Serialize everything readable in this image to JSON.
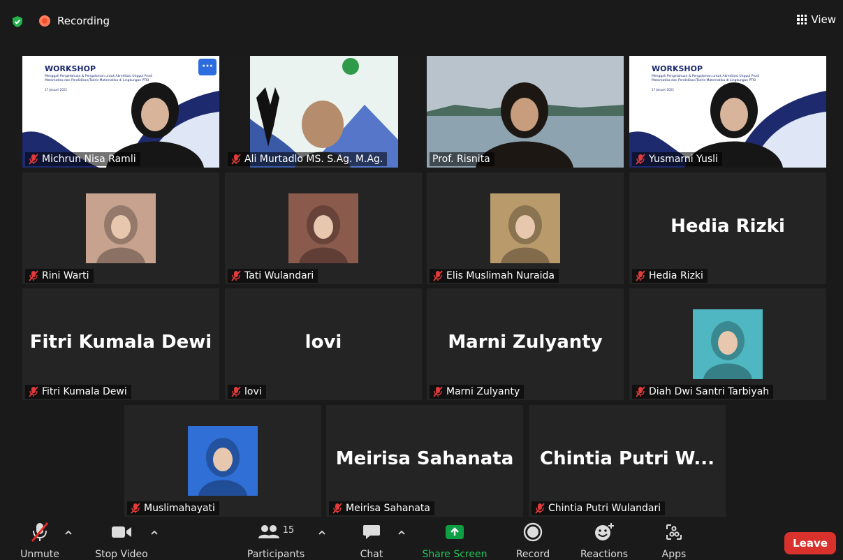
{
  "topbar": {
    "recording_label": "Recording",
    "view_label": "View"
  },
  "participants": [
    {
      "name": "Michrun Nisa Ramli",
      "type": "video",
      "scene": "workshop-slide"
    },
    {
      "name": "Ali Murtadlo MS. S.Ag. M.Ag.",
      "type": "video",
      "scene": "poster"
    },
    {
      "name": "Prof. Risnita",
      "type": "video",
      "scene": "beach",
      "speaking": true
    },
    {
      "name": "Yusmarni Yusli",
      "type": "video",
      "scene": "workshop-slide"
    },
    {
      "name": "Rini Warti",
      "type": "photo",
      "photo_color": "#c7a38f"
    },
    {
      "name": "Tati Wulandari",
      "type": "photo",
      "photo_color": "#8a5a4c"
    },
    {
      "name": "Elis Muslimah Nuraida",
      "type": "photo",
      "photo_color": "#b99a6b"
    },
    {
      "name": "Hedia Rizki",
      "type": "name",
      "display": "Hedia Rizki"
    },
    {
      "name": "Fitri Kumala Dewi",
      "type": "name",
      "display": "Fitri Kumala Dewi"
    },
    {
      "name": "lovi",
      "type": "name",
      "display": "lovi"
    },
    {
      "name": "Marni Zulyanty",
      "type": "name",
      "display": "Marni Zulyanty"
    },
    {
      "name": "Diah Dwi Santri Tarbiyah",
      "type": "photo",
      "photo_color": "#4fb7c1"
    },
    {
      "name": "Muslimahayati",
      "type": "photo",
      "photo_color": "#2f6fd6"
    },
    {
      "name": "Meirisa Sahanata",
      "type": "name",
      "display": "Meirisa Sahanata"
    },
    {
      "name": "Chintia Putri Wulandari",
      "type": "name",
      "display": "Chintia Putri W..."
    }
  ],
  "workshop": {
    "title": "WORKSHOP",
    "line1": "Menggali Pengetahuan & Pengalaman untuk Akreditasi Unggul Prodi",
    "line2": "Matematika dan Pendidikan/Tadris Matematika di Lingkungan PTKI",
    "date": "17 Januari 2023"
  },
  "toolbar": {
    "unmute": "Unmute",
    "stop_video": "Stop Video",
    "participants": "Participants",
    "participants_count": "15",
    "chat": "Chat",
    "share_screen": "Share Screen",
    "record": "Record",
    "reactions": "Reactions",
    "apps": "Apps",
    "leave": "Leave"
  },
  "colors": {
    "accent_green": "#0e9f45",
    "leave_red": "#d9312b",
    "speaking_border": "#c8e27a"
  }
}
